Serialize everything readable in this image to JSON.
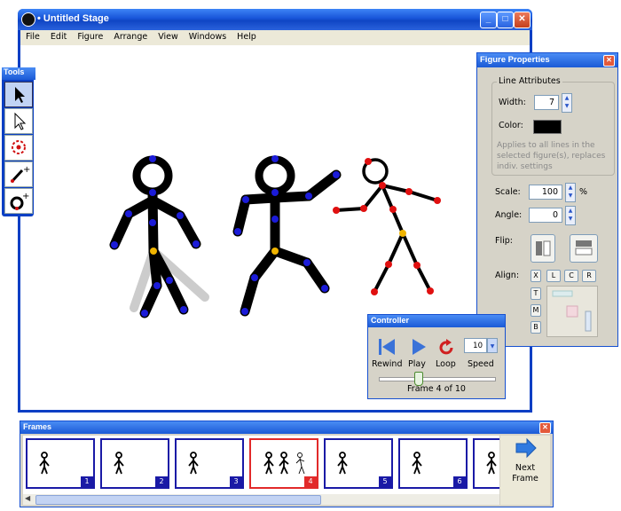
{
  "window": {
    "title": "• Untitled Stage",
    "menu": [
      "File",
      "Edit",
      "Figure",
      "Arrange",
      "View",
      "Windows",
      "Help"
    ]
  },
  "tools": {
    "title": "Tools",
    "items": [
      {
        "icon": "arrow-pointer-icon",
        "selected": true
      },
      {
        "icon": "hollow-arrow-pointer-icon",
        "selected": false
      },
      {
        "icon": "joint-target-icon",
        "selected": false
      },
      {
        "icon": "add-line-icon",
        "selected": false
      },
      {
        "icon": "add-circle-icon",
        "selected": false
      }
    ]
  },
  "figure_properties": {
    "title": "Figure Properties",
    "line_attributes_label": "Line Attributes",
    "width_label": "Width:",
    "width_value": "7",
    "color_label": "Color:",
    "line_color": "#000000",
    "note": "Applies to all lines in the selected figure(s), replaces indiv. settings",
    "scale_label": "Scale:",
    "scale_value": "100",
    "scale_unit": "%",
    "angle_label": "Angle:",
    "angle_value": "0",
    "flip_label": "Flip:",
    "align_label": "Align:",
    "align_x": "X",
    "align_l": "L",
    "align_c": "C",
    "align_r": "R",
    "align_t": "T",
    "align_m": "M",
    "align_b": "B"
  },
  "controller": {
    "title": "Controller",
    "rewind_label": "Rewind",
    "play_label": "Play",
    "loop_label": "Loop",
    "speed_label": "Speed",
    "speed_value": "10",
    "frame_status": "Frame 4 of 10",
    "slider_position": 0.33
  },
  "frames": {
    "title": "Frames",
    "next_label": "Next Frame",
    "items": [
      {
        "number": "1",
        "current": false
      },
      {
        "number": "2",
        "current": false
      },
      {
        "number": "3",
        "current": false
      },
      {
        "number": "4",
        "current": true
      },
      {
        "number": "5",
        "current": false
      },
      {
        "number": "6",
        "current": false
      }
    ]
  },
  "colors": {
    "xp_title_blue": "#1754d8",
    "joint_blue": "#1b1bd8",
    "joint_red": "#e01010",
    "joint_orange": "#f0b400",
    "frame_current_border": "#e22a2a",
    "frame_border": "#1a1aa6"
  }
}
